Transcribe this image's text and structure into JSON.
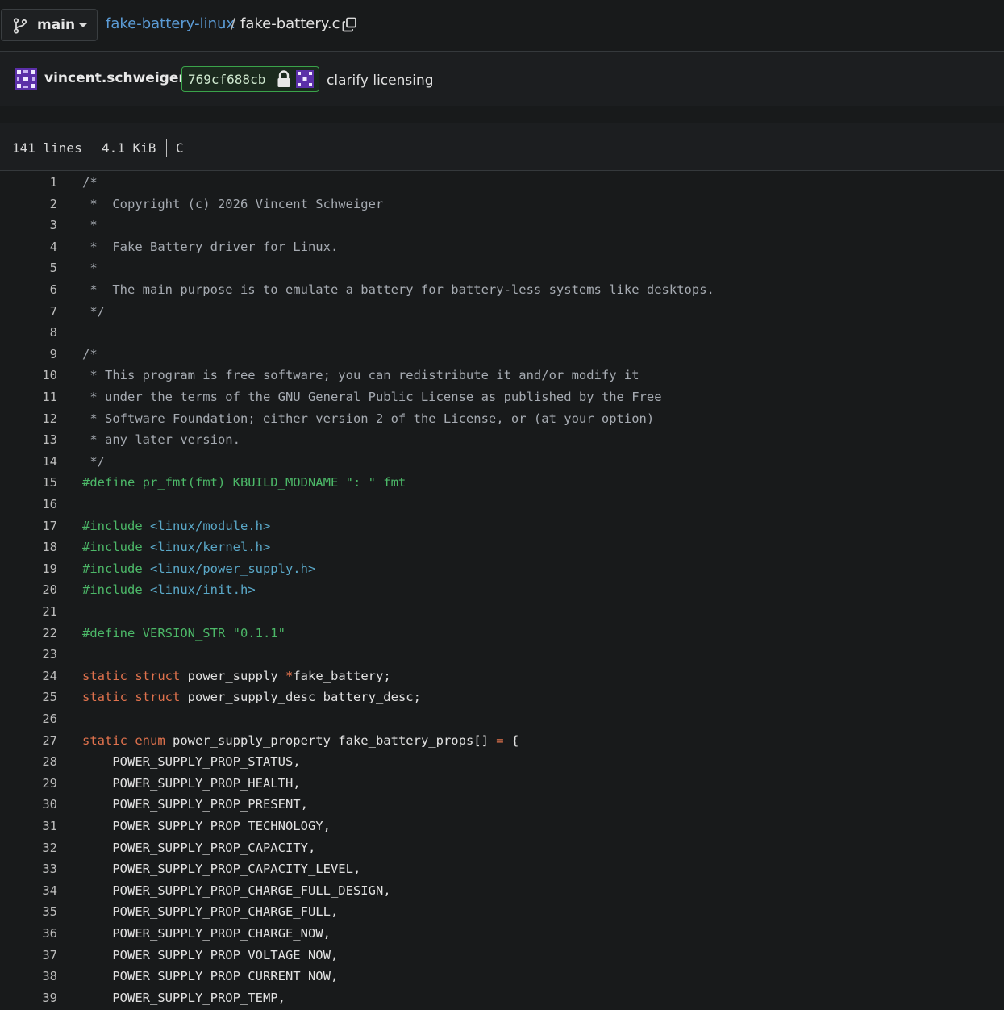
{
  "breadcrumb": {
    "branch": "main",
    "repo": "fake-battery-linux",
    "separator": "/",
    "file": "fake-battery.c"
  },
  "commit": {
    "author": "vincent.schweiger",
    "sha": "769cf688cb",
    "message": "clarify licensing"
  },
  "file_info": {
    "lines": "141 lines",
    "size": "4.1 KiB",
    "language": "C"
  },
  "colors": {
    "comment": "#a6abb2",
    "preprocessor": "#4cb868",
    "keyword": "#e0724d",
    "link": "#5b9bd5",
    "sha_border": "#3aa34a"
  },
  "code_lines": [
    {
      "n": "1",
      "t": "/*",
      "k": "comment"
    },
    {
      "n": "2",
      "t": " *  Copyright (c) 2026 Vincent Schweiger",
      "k": "comment"
    },
    {
      "n": "3",
      "t": " *",
      "k": "comment"
    },
    {
      "n": "4",
      "t": " *  Fake Battery driver for Linux.",
      "k": "comment"
    },
    {
      "n": "5",
      "t": " *",
      "k": "comment"
    },
    {
      "n": "6",
      "t": " *  The main purpose is to emulate a battery for battery-less systems like desktops.",
      "k": "comment"
    },
    {
      "n": "7",
      "t": " */",
      "k": "comment"
    },
    {
      "n": "8",
      "t": "",
      "k": "plain"
    },
    {
      "n": "9",
      "t": "/*",
      "k": "comment"
    },
    {
      "n": "10",
      "t": " * This program is free software; you can redistribute it and/or modify it",
      "k": "comment"
    },
    {
      "n": "11",
      "t": " * under the terms of the GNU General Public License as published by the Free",
      "k": "comment"
    },
    {
      "n": "12",
      "t": " * Software Foundation; either version 2 of the License, or (at your option)",
      "k": "comment"
    },
    {
      "n": "13",
      "t": " * any later version.",
      "k": "comment"
    },
    {
      "n": "14",
      "t": " */",
      "k": "comment"
    },
    {
      "n": "15",
      "t": "#define pr_fmt(fmt) KBUILD_MODNAME \": \" fmt",
      "k": "pre"
    },
    {
      "n": "16",
      "t": "",
      "k": "plain"
    },
    {
      "n": "17",
      "t": "#include <linux/module.h>",
      "k": "include"
    },
    {
      "n": "18",
      "t": "#include <linux/kernel.h>",
      "k": "include"
    },
    {
      "n": "19",
      "t": "#include <linux/power_supply.h>",
      "k": "include"
    },
    {
      "n": "20",
      "t": "#include <linux/init.h>",
      "k": "include"
    },
    {
      "n": "21",
      "t": "",
      "k": "plain"
    },
    {
      "n": "22",
      "t": "#define VERSION_STR \"0.1.1\"",
      "k": "pre"
    },
    {
      "n": "23",
      "t": "",
      "k": "plain"
    },
    {
      "n": "24",
      "t": "static struct power_supply *fake_battery;",
      "k": "decl1"
    },
    {
      "n": "25",
      "t": "static struct power_supply_desc battery_desc;",
      "k": "decl2"
    },
    {
      "n": "26",
      "t": "",
      "k": "plain"
    },
    {
      "n": "27",
      "t": "static enum power_supply_property fake_battery_props[] = {",
      "k": "decl3"
    },
    {
      "n": "28",
      "t": "    POWER_SUPPLY_PROP_STATUS,",
      "k": "plain"
    },
    {
      "n": "29",
      "t": "    POWER_SUPPLY_PROP_HEALTH,",
      "k": "plain"
    },
    {
      "n": "30",
      "t": "    POWER_SUPPLY_PROP_PRESENT,",
      "k": "plain"
    },
    {
      "n": "31",
      "t": "    POWER_SUPPLY_PROP_TECHNOLOGY,",
      "k": "plain"
    },
    {
      "n": "32",
      "t": "    POWER_SUPPLY_PROP_CAPACITY,",
      "k": "plain"
    },
    {
      "n": "33",
      "t": "    POWER_SUPPLY_PROP_CAPACITY_LEVEL,",
      "k": "plain"
    },
    {
      "n": "34",
      "t": "    POWER_SUPPLY_PROP_CHARGE_FULL_DESIGN,",
      "k": "plain"
    },
    {
      "n": "35",
      "t": "    POWER_SUPPLY_PROP_CHARGE_FULL,",
      "k": "plain"
    },
    {
      "n": "36",
      "t": "    POWER_SUPPLY_PROP_CHARGE_NOW,",
      "k": "plain"
    },
    {
      "n": "37",
      "t": "    POWER_SUPPLY_PROP_VOLTAGE_NOW,",
      "k": "plain"
    },
    {
      "n": "38",
      "t": "    POWER_SUPPLY_PROP_CURRENT_NOW,",
      "k": "plain"
    },
    {
      "n": "39",
      "t": "    POWER_SUPPLY_PROP_TEMP,",
      "k": "plain"
    }
  ]
}
